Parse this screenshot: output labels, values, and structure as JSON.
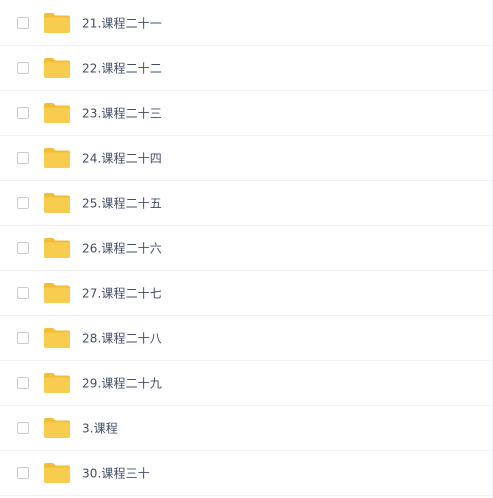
{
  "folder_color": "#f8cd4f",
  "folder_tab_color": "#f3bd37",
  "items": [
    {
      "name": "21.课程二十一",
      "icon": "folder-icon"
    },
    {
      "name": "22.课程二十二",
      "icon": "folder-icon"
    },
    {
      "name": "23.课程二十三",
      "icon": "folder-icon"
    },
    {
      "name": "24.课程二十四",
      "icon": "folder-icon"
    },
    {
      "name": "25.课程二十五",
      "icon": "folder-icon"
    },
    {
      "name": "26.课程二十六",
      "icon": "folder-icon"
    },
    {
      "name": "27.课程二十七",
      "icon": "folder-icon"
    },
    {
      "name": "28.课程二十八",
      "icon": "folder-icon"
    },
    {
      "name": "29.课程二十九",
      "icon": "folder-icon"
    },
    {
      "name": "3.课程",
      "icon": "folder-icon"
    },
    {
      "name": "30.课程三十",
      "icon": "folder-icon"
    }
  ]
}
